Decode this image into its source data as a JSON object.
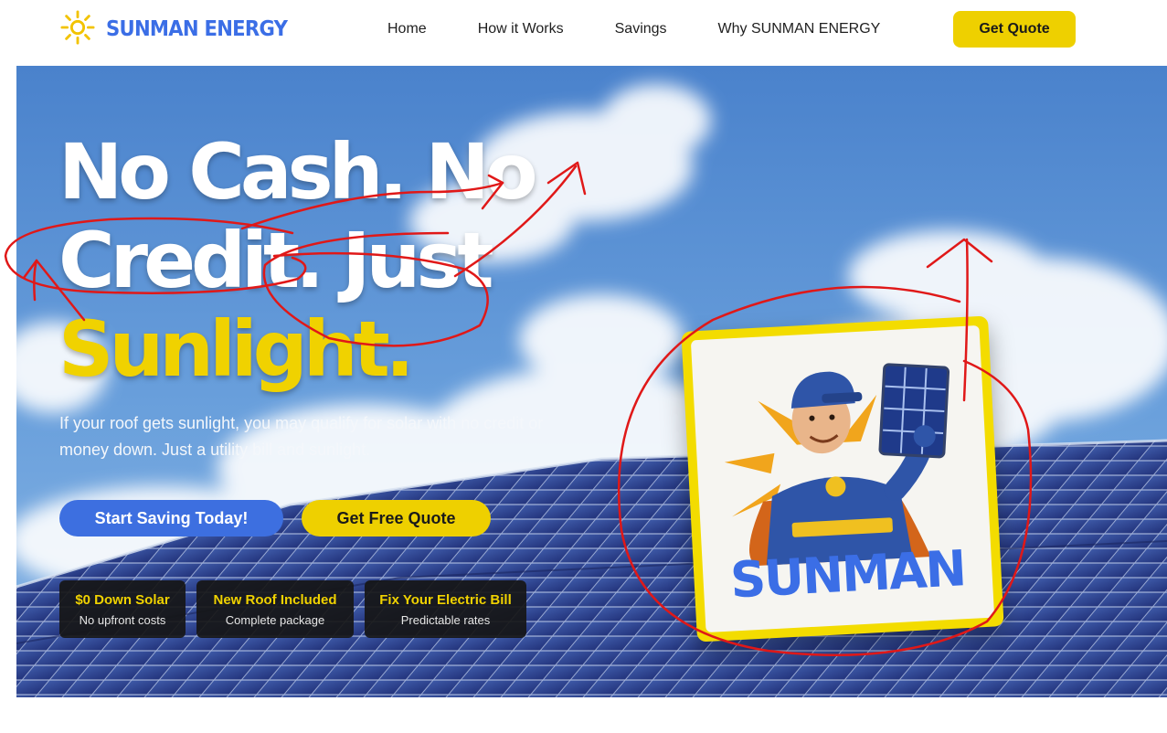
{
  "nav": {
    "brand": "SUNMAN ENERGY",
    "links": [
      "Home",
      "How it Works",
      "Savings",
      "Why SUNMAN ENERGY"
    ],
    "cta": "Get Quote"
  },
  "hero": {
    "headline_white": "No Cash. No Credit. Just",
    "headline_highlight": "Sunlight.",
    "subtext": "If your roof gets sunlight, you may qualify for solar with no credit or money down. Just a utility bill and sunlight.",
    "primary_cta": "Start Saving Today!",
    "secondary_cta": "Get Free Quote",
    "badges": [
      {
        "title": "$0 Down Solar",
        "subtitle": "No upfront costs"
      },
      {
        "title": "New Roof Included",
        "subtitle": "Complete package"
      },
      {
        "title": "Fix Your Electric Bill",
        "subtitle": "Predictable rates"
      }
    ],
    "mascot_label": "SUNMAN"
  },
  "icons": {
    "brand_logo": "sun-icon",
    "annotations": "red-pen-scribbles"
  },
  "colors": {
    "brand_blue": "#3b6ee6",
    "accent_yellow": "#eed000",
    "annotation_red": "#e01818"
  }
}
